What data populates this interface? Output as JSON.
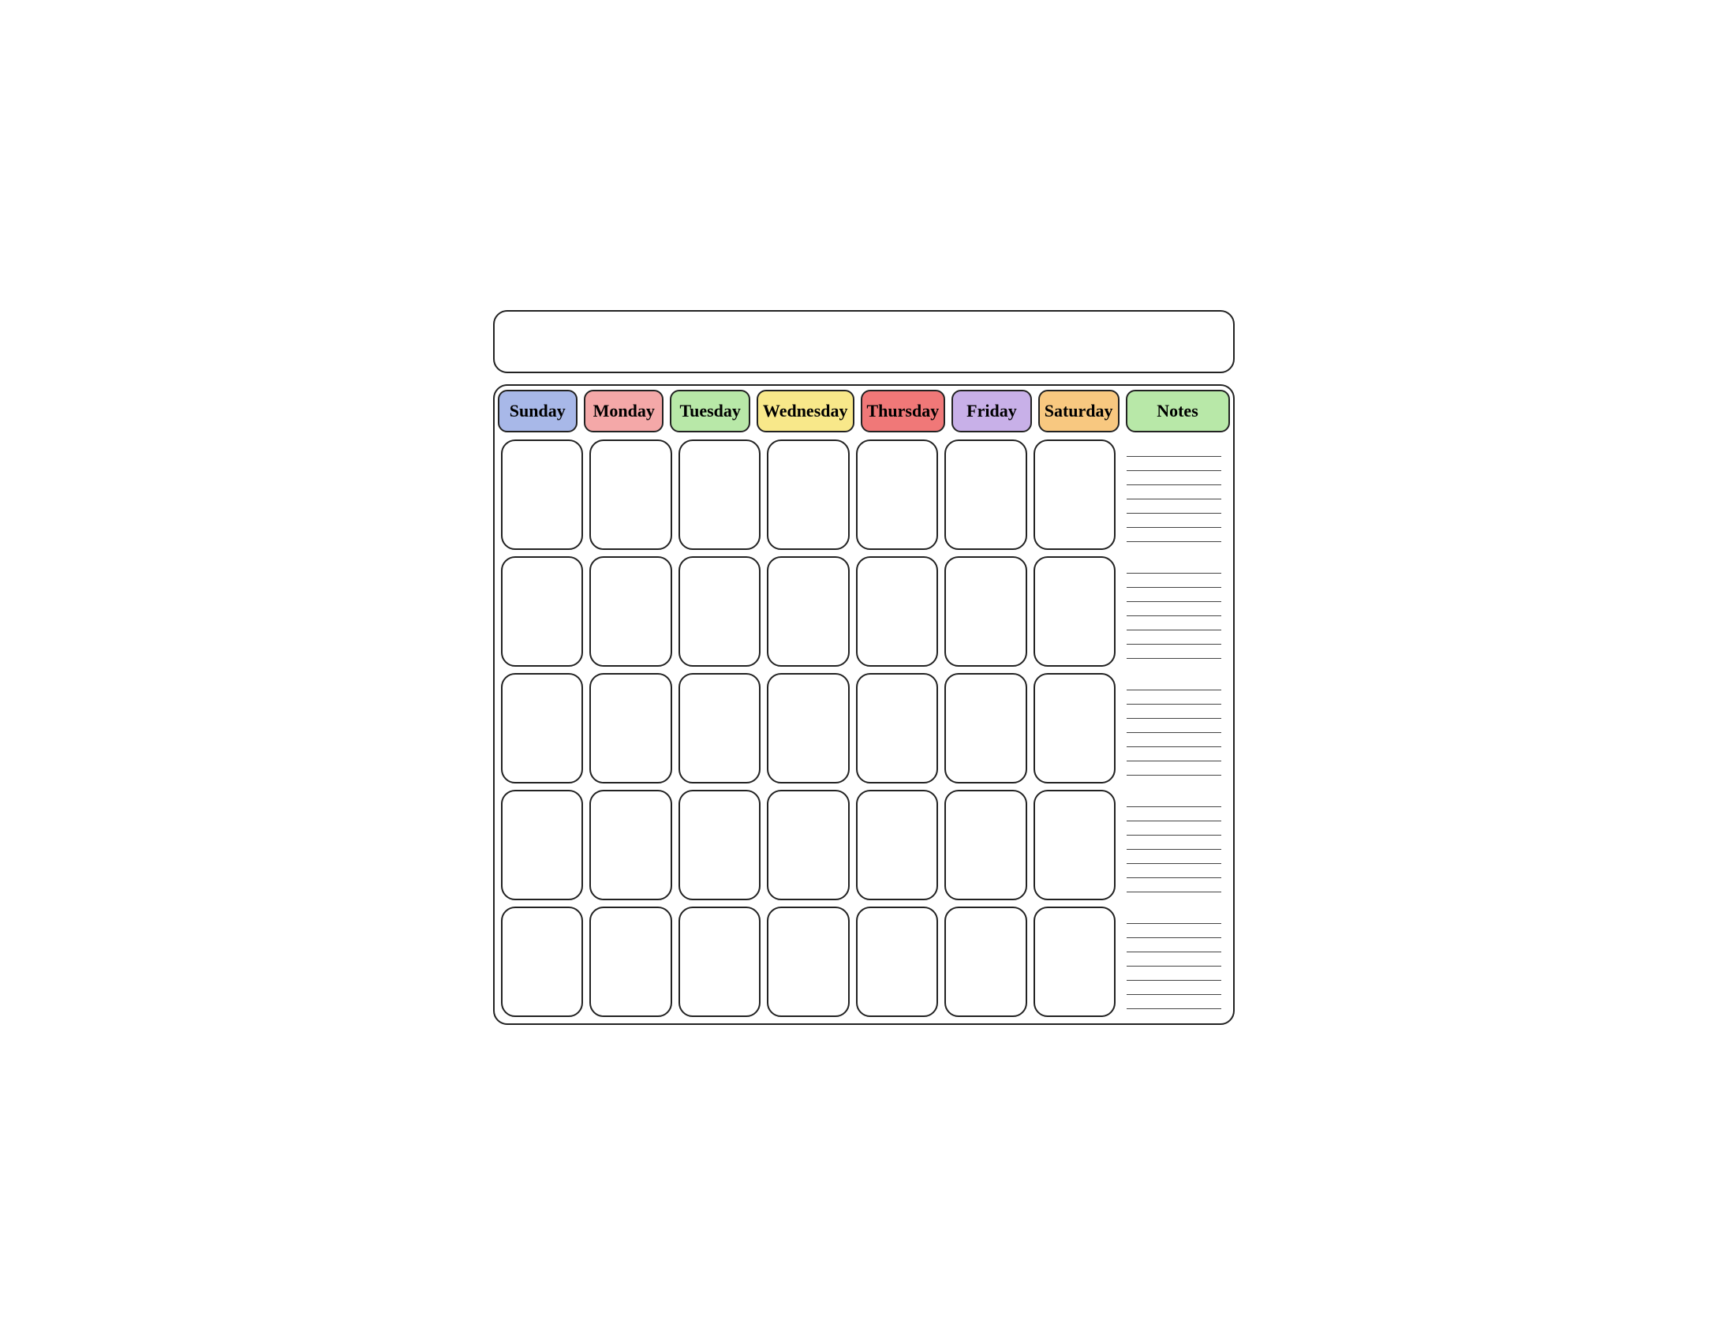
{
  "header": {
    "title": ""
  },
  "days": {
    "sunday": {
      "label": "Sunday",
      "colorClass": "header-sunday"
    },
    "monday": {
      "label": "Monday",
      "colorClass": "header-monday"
    },
    "tuesday": {
      "label": "Tuesday",
      "colorClass": "header-tuesday"
    },
    "wednesday": {
      "label": "Wednesday",
      "colorClass": "header-wednesday"
    },
    "thursday": {
      "label": "Thursday",
      "colorClass": "header-thursday"
    },
    "friday": {
      "label": "Friday",
      "colorClass": "header-friday"
    },
    "saturday": {
      "label": "Saturday",
      "colorClass": "header-saturday"
    },
    "notes": {
      "label": "Notes",
      "colorClass": "header-notes"
    }
  },
  "rows": 5,
  "notes_lines": 35
}
